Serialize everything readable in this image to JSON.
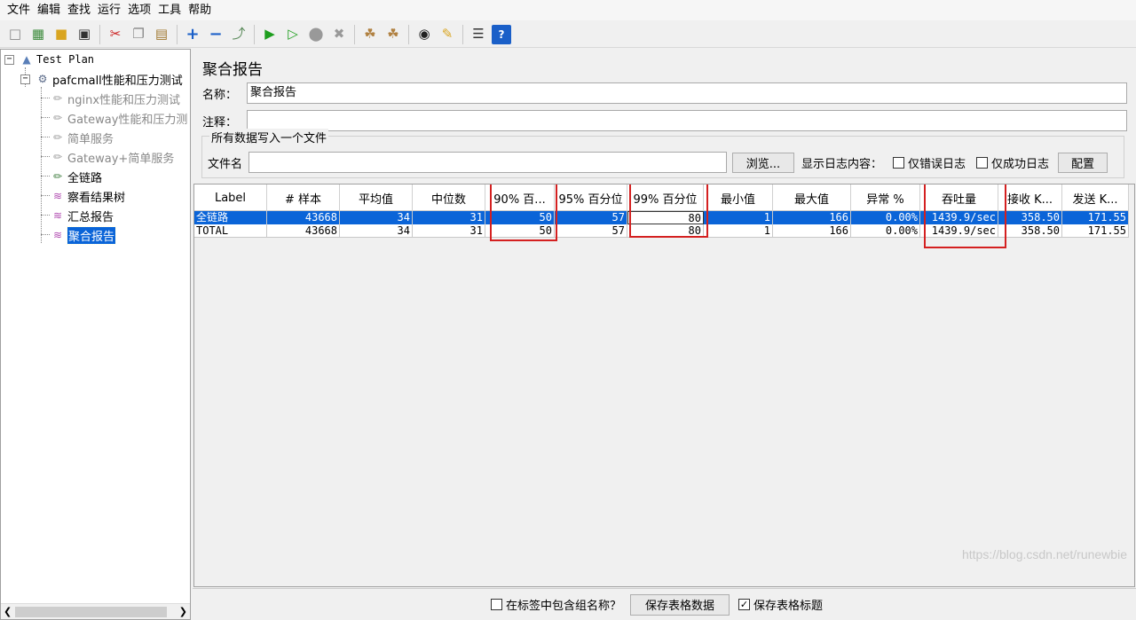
{
  "menu": [
    "文件",
    "编辑",
    "查找",
    "运行",
    "选项",
    "工具",
    "帮助"
  ],
  "toolbar_icons": [
    "new-icon",
    "templates-icon",
    "open-icon",
    "save-icon",
    "cut-icon",
    "copy-icon",
    "paste-icon",
    "expand-icon",
    "collapse-icon",
    "toggle-icon",
    "start-icon",
    "start-no-pause-icon",
    "stop-icon",
    "shutdown-icon",
    "clear-icon",
    "clear-all-icon",
    "search-icon",
    "reset-search-icon",
    "function-helper-icon",
    "help-icon"
  ],
  "tree": {
    "test_plan": "Test Plan",
    "thread_group": "pafcmall性能和压力测试",
    "items": [
      {
        "label": "nginx性能和压力测试",
        "icon": "sampler-icon",
        "disabled": true
      },
      {
        "label": "Gateway性能和压力测",
        "icon": "sampler-icon",
        "disabled": true
      },
      {
        "label": "简单服务",
        "icon": "sampler-icon",
        "disabled": true
      },
      {
        "label": "Gateway+简单服务",
        "icon": "sampler-icon",
        "disabled": true
      },
      {
        "label": "全链路",
        "icon": "sampler-icon",
        "disabled": false
      },
      {
        "label": "察看结果树",
        "icon": "listener-icon",
        "disabled": false
      },
      {
        "label": "汇总报告",
        "icon": "listener-icon",
        "disabled": false
      },
      {
        "label": "聚合报告",
        "icon": "listener-icon",
        "disabled": false,
        "selected": true
      }
    ]
  },
  "panel": {
    "title": "聚合报告",
    "name_label": "名称：",
    "name_value": "聚合报告",
    "comment_label": "注释：",
    "comment_value": "",
    "file_group_title": "所有数据写入一个文件",
    "filename_label": "文件名",
    "filename_value": "",
    "browse_button": "浏览...",
    "log_content_label": "显示日志内容：",
    "errors_only_label": "仅错误日志",
    "success_only_label": "仅成功日志",
    "configure_button": "配置"
  },
  "table": {
    "columns": [
      "Label",
      "# 样本",
      "平均值",
      "中位数",
      "90% 百...",
      "95% 百分位",
      "99% 百分位",
      "最小值",
      "最大值",
      "异常 %",
      "吞吐量",
      "接收 K...",
      "发送 K..."
    ],
    "rows": [
      [
        "全链路",
        "43668",
        "34",
        "31",
        "50",
        "57",
        "80",
        "1",
        "166",
        "0.00%",
        "1439.9/sec",
        "358.50",
        "171.55"
      ],
      [
        "TOTAL",
        "43668",
        "34",
        "31",
        "50",
        "57",
        "80",
        "1",
        "166",
        "0.00%",
        "1439.9/sec",
        "358.50",
        "171.55"
      ]
    ]
  },
  "bottom": {
    "include_group_label": "在标签中包含组名称？",
    "save_table_button": "保存表格数据",
    "save_header_label": "保存表格标题",
    "save_header_checked": "✓"
  },
  "watermark": "https://blog.csdn.net/runewbie",
  "colors": {
    "selection": "#0a64d8",
    "highlight_box": "#d42020"
  }
}
